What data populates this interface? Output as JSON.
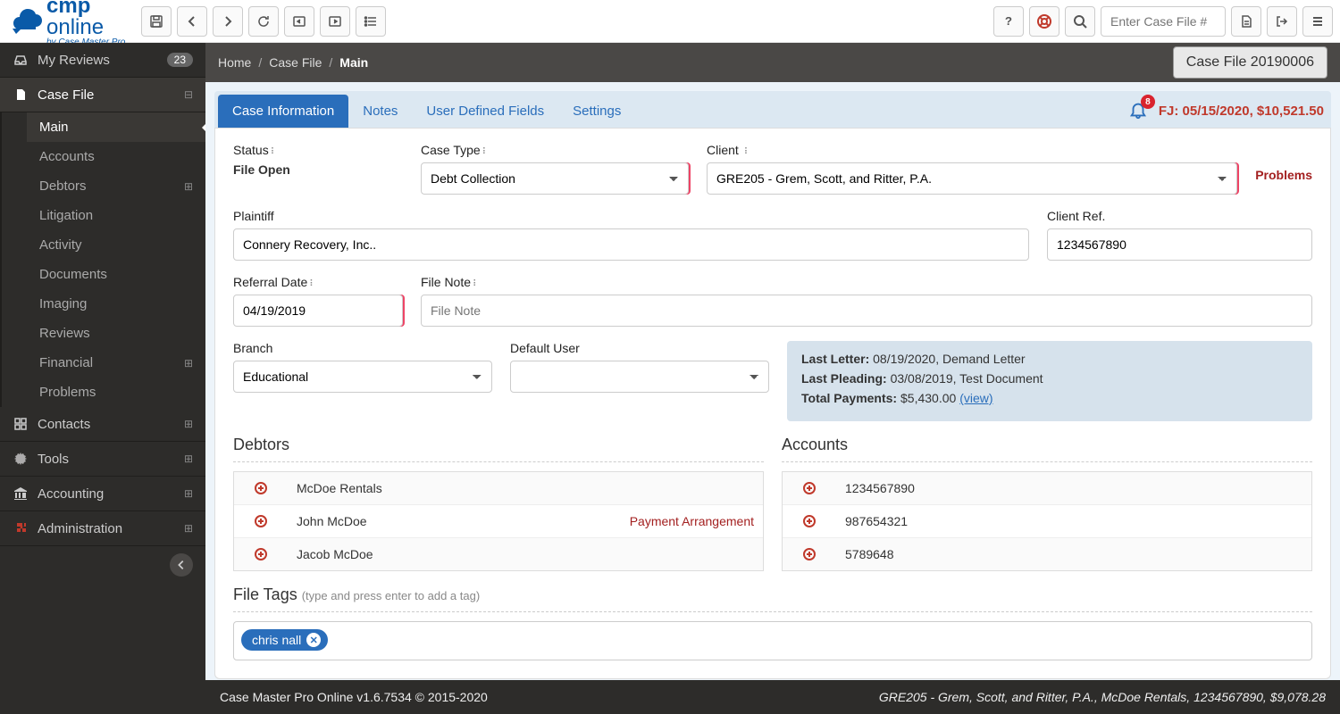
{
  "brand": {
    "name_bold": "cmp",
    "name_rest": "online",
    "byline": "by Case Master Pro"
  },
  "topbar": {
    "search_placeholder": "Enter Case File #"
  },
  "sidebar": {
    "reviews": {
      "label": "My Reviews",
      "badge": "23"
    },
    "casefile": {
      "label": "Case File"
    },
    "items": [
      {
        "label": "Main",
        "active": true
      },
      {
        "label": "Accounts"
      },
      {
        "label": "Debtors",
        "expand": true
      },
      {
        "label": "Litigation"
      },
      {
        "label": "Activity"
      },
      {
        "label": "Documents"
      },
      {
        "label": "Imaging"
      },
      {
        "label": "Reviews"
      },
      {
        "label": "Financial",
        "expand": true
      },
      {
        "label": "Problems"
      }
    ],
    "contacts": {
      "label": "Contacts"
    },
    "tools": {
      "label": "Tools"
    },
    "accounting": {
      "label": "Accounting"
    },
    "administration": {
      "label": "Administration"
    }
  },
  "breadcrumb": {
    "home": "Home",
    "casefile": "Case File",
    "main": "Main",
    "case_button": "Case File 20190006"
  },
  "tabs": {
    "case_info": "Case Information",
    "notes": "Notes",
    "udf": "User Defined Fields",
    "settings": "Settings"
  },
  "alerts": {
    "count": "8",
    "fj": "FJ: 05/15/2020, $10,521.50"
  },
  "form": {
    "status_label": "Status",
    "status_value": "File Open",
    "case_type_label": "Case Type",
    "case_type_value": "Debt Collection",
    "client_label": "Client",
    "client_value": "GRE205 - Grem, Scott, and Ritter, P.A.",
    "problems_label": "Problems",
    "plaintiff_label": "Plaintiff",
    "plaintiff_value": "Connery Recovery, Inc..",
    "clientref_label": "Client Ref.",
    "clientref_value": "1234567890",
    "refdate_label": "Referral Date",
    "refdate_value": "04/19/2019",
    "filenote_label": "File Note",
    "filenote_placeholder": "File Note",
    "branch_label": "Branch",
    "branch_value": "Educational",
    "defaultuser_label": "Default User",
    "defaultuser_value": ""
  },
  "info": {
    "last_letter_label": "Last Letter:",
    "last_letter_value": "08/19/2020, Demand Letter",
    "last_pleading_label": "Last Pleading:",
    "last_pleading_value": "03/08/2019, Test Document",
    "total_payments_label": "Total Payments:",
    "total_payments_value": "$5,430.00",
    "view": "(view)"
  },
  "debtors": {
    "title": "Debtors",
    "rows": [
      {
        "name": "McDoe Rentals"
      },
      {
        "name": "John McDoe",
        "tag": "Payment Arrangement"
      },
      {
        "name": "Jacob McDoe"
      }
    ]
  },
  "accounts": {
    "title": "Accounts",
    "rows": [
      {
        "num": "1234567890"
      },
      {
        "num": "987654321"
      },
      {
        "num": "5789648"
      }
    ]
  },
  "filetags": {
    "title": "File Tags",
    "hint": "(type and press enter to add a tag)",
    "tags": [
      "chris nall"
    ]
  },
  "footer": {
    "left": "Case Master Pro Online v1.6.7534 © 2015-2020",
    "right": "GRE205 - Grem, Scott, and Ritter, P.A., McDoe Rentals, 1234567890, $9,078.28"
  }
}
